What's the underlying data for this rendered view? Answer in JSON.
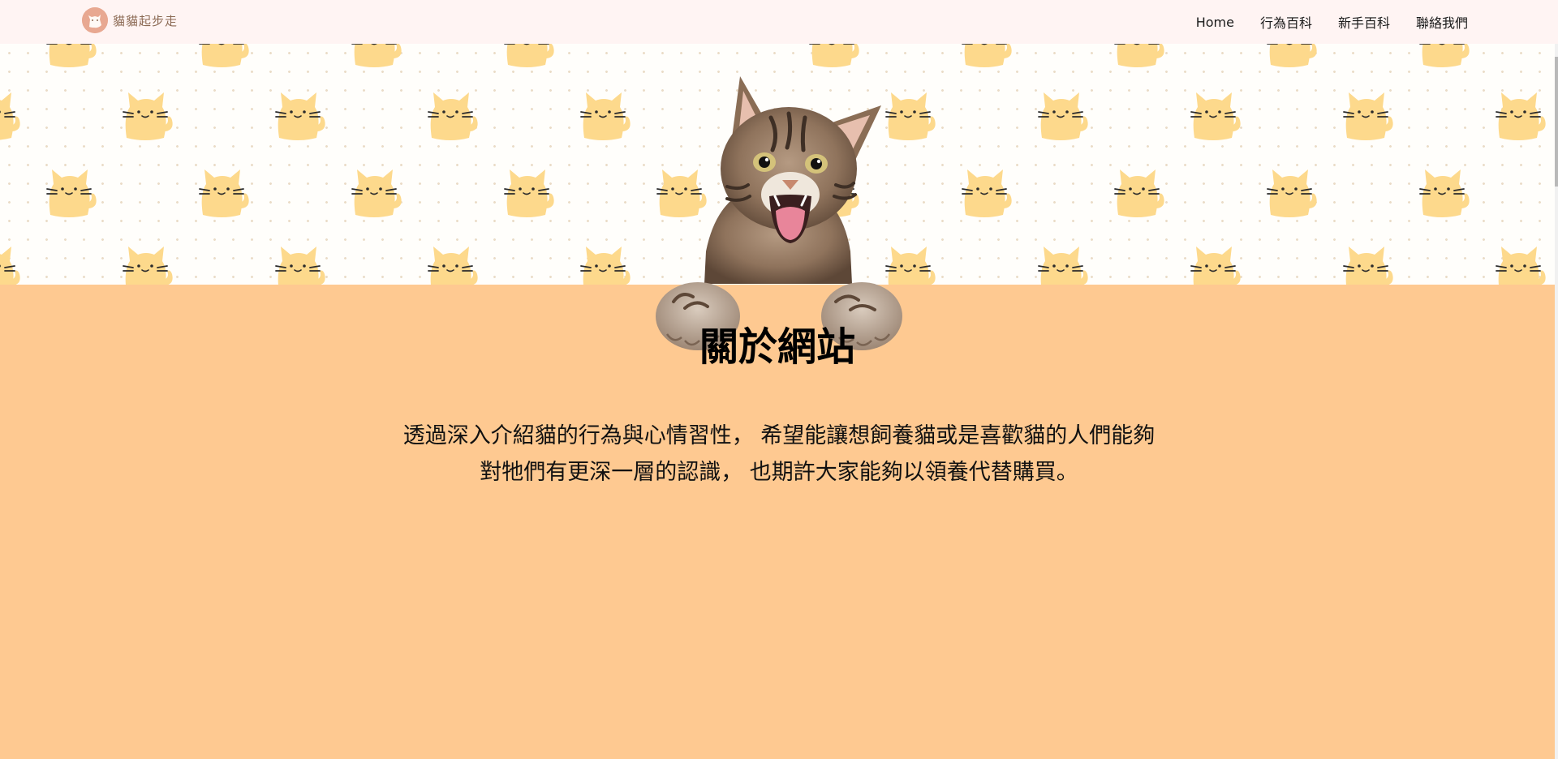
{
  "navbar": {
    "brand_name": "貓貓起步走",
    "links": [
      {
        "label": "Home"
      },
      {
        "label": "行為百科"
      },
      {
        "label": "新手百科"
      },
      {
        "label": "聯絡我們"
      }
    ]
  },
  "about": {
    "title": "關於網站",
    "description_line1": "透過深入介紹貓的行為與心情習性， 希望能讓想飼養貓或是喜歡貓的人們能夠",
    "description_line2": "對牠們有更深一層的認識， 也期許大家能夠以領養代替購買。"
  },
  "theme": {
    "nav_bg": "#fff4f3",
    "hero_bg": "#fffefb",
    "section_bg": "#fec991",
    "pattern_cat_color": "#fdd98c",
    "logo_bg": "#e8a891"
  }
}
